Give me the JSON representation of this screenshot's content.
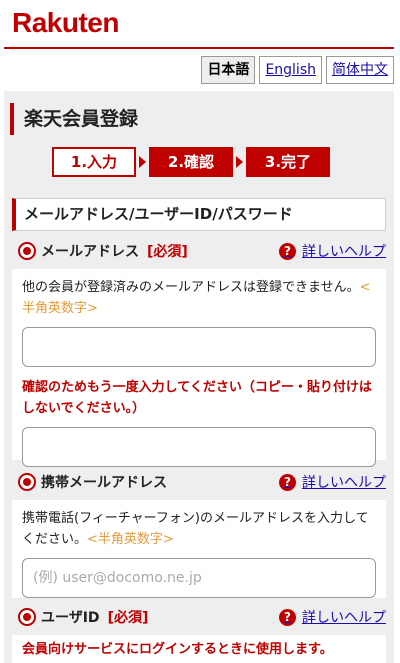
{
  "header": {
    "logo_text": "Rakuten"
  },
  "languages": [
    {
      "label": "日本語",
      "active": true
    },
    {
      "label": "English",
      "active": false
    },
    {
      "label": "简体中文",
      "active": false
    }
  ],
  "page": {
    "title": "楽天会員登録"
  },
  "steps": [
    {
      "label": "1.入力",
      "active": false
    },
    {
      "label": "2.確認",
      "active": true
    },
    {
      "label": "3.完了",
      "active": true
    }
  ],
  "section": {
    "title": "メールアドレス/ユーザーID/パスワード"
  },
  "fields": {
    "email": {
      "label": "メールアドレス",
      "required": "[必須]",
      "help": "詳しいヘルプ",
      "description": "他の会員が登録済みのメールアドレスは登録できません。",
      "hint": "<半角英数字>",
      "value": "",
      "confirm_warning": "確認のためもう一度入力してください（コピー・貼り付けはしないでください。）",
      "confirm_value": ""
    },
    "mobile_email": {
      "label": "携帯メールアドレス",
      "help": "詳しいヘルプ",
      "description": "携帯電話(フィーチャーフォン)のメールアドレスを入力してください。",
      "hint": "<半角英数字>",
      "placeholder": "(例) user@docomo.ne.jp"
    },
    "user_id": {
      "label": "ユーザID",
      "required": "[必須]",
      "help": "詳しいヘルプ",
      "description": "会員向けサービスにログインするときに使用します。"
    }
  },
  "colors": {
    "brand": "#bf0000",
    "hint": "#e69b3a",
    "link": "#1a0dab",
    "panel": "#eeeeee"
  }
}
